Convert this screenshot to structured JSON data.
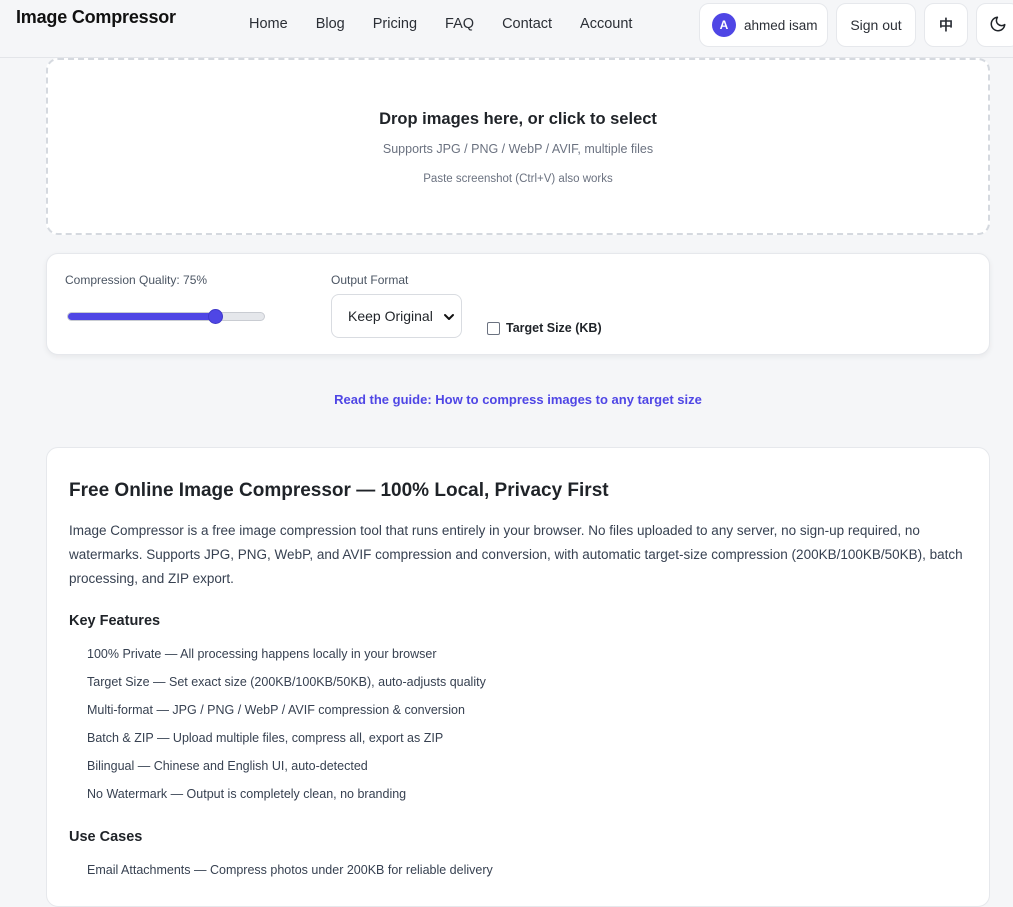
{
  "header": {
    "logo": "Image Compressor",
    "nav": [
      "Home",
      "Blog",
      "Pricing",
      "FAQ",
      "Contact",
      "Account"
    ],
    "user": {
      "initial": "A",
      "name": "ahmed isam"
    },
    "signout_label": "Sign out",
    "lang_label": "中",
    "theme_icon": "moon-icon"
  },
  "dropzone": {
    "title": "Drop images here, or click to select",
    "subtitle": "Supports JPG / PNG / WebP / AVIF, multiple files",
    "paste_hint": "Paste screenshot (Ctrl+V) also works"
  },
  "settings": {
    "quality_label": "Compression Quality: 75%",
    "quality_value": 75,
    "format_label": "Output Format",
    "format_value": "Keep Original",
    "target_size_label": "Target Size (KB)",
    "target_size_checked": false
  },
  "guide_link": "Read the guide: How to compress images to any target size",
  "article": {
    "title": "Free Online Image Compressor — 100% Local, Privacy First",
    "intro": "Image Compressor is a free image compression tool that runs entirely in your browser. No files uploaded to any server, no sign-up required, no watermarks. Supports JPG, PNG, WebP, and AVIF compression and conversion, with automatic target-size compression (200KB/100KB/50KB), batch processing, and ZIP export.",
    "features_title": "Key Features",
    "features": [
      "100% Private — All processing happens locally in your browser",
      "Target Size — Set exact size (200KB/100KB/50KB), auto-adjusts quality",
      "Multi-format — JPG / PNG / WebP / AVIF compression & conversion",
      "Batch & ZIP — Upload multiple files, compress all, export as ZIP",
      "Bilingual — Chinese and English UI, auto-detected",
      "No Watermark — Output is completely clean, no branding"
    ],
    "use_cases_title": "Use Cases",
    "use_cases": [
      "Email Attachments — Compress photos under 200KB for reliable delivery"
    ]
  },
  "colors": {
    "accent": "#4f46e5",
    "background": "#f5f6f8"
  }
}
